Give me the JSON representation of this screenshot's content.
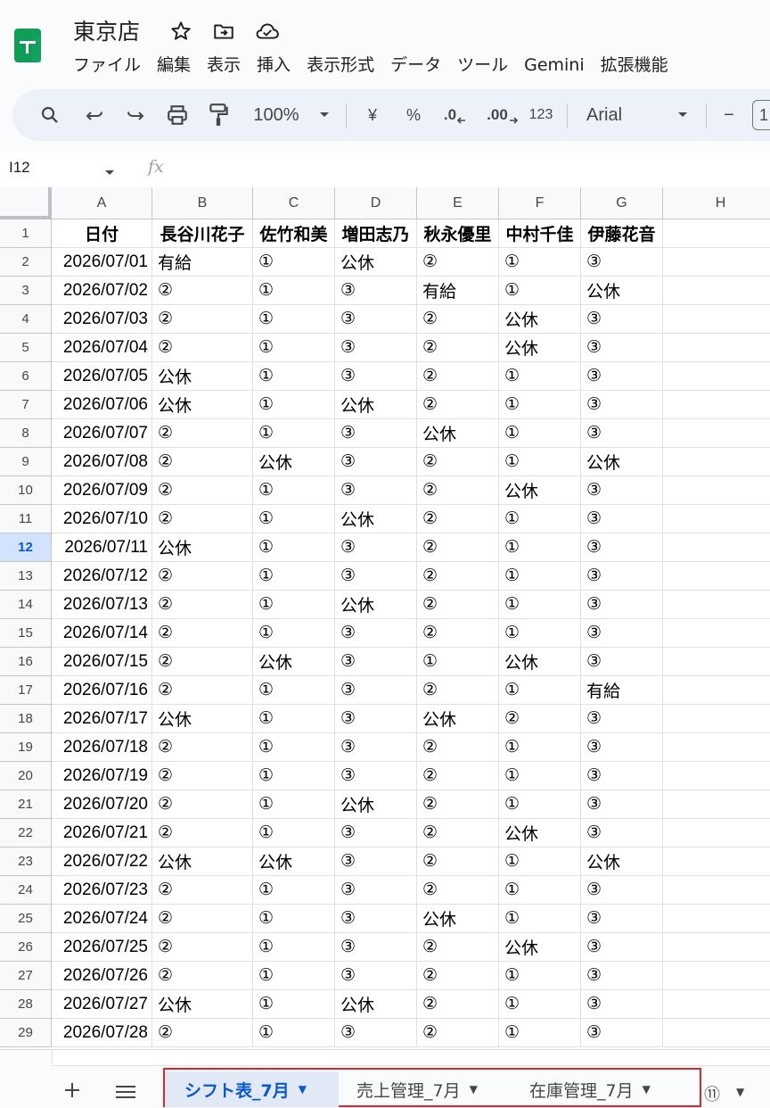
{
  "header": {
    "title": "東京店",
    "menus": [
      "ファイル",
      "編集",
      "表示",
      "挿入",
      "表示形式",
      "データ",
      "ツール",
      "Gemini",
      "拡張機能"
    ]
  },
  "toolbar": {
    "zoom": "100%",
    "currency": "¥",
    "percent": "%",
    "decimal_decrease": ".0",
    "decimal_increase": ".00",
    "number_format": "123",
    "font": "Arial",
    "minus": "−",
    "font_size_partial": "1"
  },
  "formula_bar": {
    "cell_ref": "I12",
    "fx": "fx"
  },
  "grid": {
    "columns": [
      "A",
      "B",
      "C",
      "D",
      "E",
      "F",
      "G",
      "H"
    ],
    "header_row": [
      "日付",
      "長谷川花子",
      "佐竹和美",
      "増田志乃",
      "秋永優里",
      "中村千佳",
      "伊藤花音",
      ""
    ],
    "rows": [
      [
        "2026/07/01",
        "有給",
        "①",
        "公休",
        "②",
        "①",
        "③",
        ""
      ],
      [
        "2026/07/02",
        "②",
        "①",
        "③",
        "有給",
        "①",
        "公休",
        ""
      ],
      [
        "2026/07/03",
        "②",
        "①",
        "③",
        "②",
        "公休",
        "③",
        ""
      ],
      [
        "2026/07/04",
        "②",
        "①",
        "③",
        "②",
        "公休",
        "③",
        ""
      ],
      [
        "2026/07/05",
        "公休",
        "①",
        "③",
        "②",
        "①",
        "③",
        ""
      ],
      [
        "2026/07/06",
        "公休",
        "①",
        "公休",
        "②",
        "①",
        "③",
        ""
      ],
      [
        "2026/07/07",
        "②",
        "①",
        "③",
        "公休",
        "①",
        "③",
        ""
      ],
      [
        "2026/07/08",
        "②",
        "公休",
        "③",
        "②",
        "①",
        "公休",
        ""
      ],
      [
        "2026/07/09",
        "②",
        "①",
        "③",
        "②",
        "公休",
        "③",
        ""
      ],
      [
        "2026/07/10",
        "②",
        "①",
        "公休",
        "②",
        "①",
        "③",
        ""
      ],
      [
        "2026/07/11",
        "公休",
        "①",
        "③",
        "②",
        "①",
        "③",
        ""
      ],
      [
        "2026/07/12",
        "②",
        "①",
        "③",
        "②",
        "①",
        "③",
        ""
      ],
      [
        "2026/07/13",
        "②",
        "①",
        "公休",
        "②",
        "①",
        "③",
        ""
      ],
      [
        "2026/07/14",
        "②",
        "①",
        "③",
        "②",
        "①",
        "③",
        ""
      ],
      [
        "2026/07/15",
        "②",
        "公休",
        "③",
        "①",
        "公休",
        "③",
        ""
      ],
      [
        "2026/07/16",
        "②",
        "①",
        "③",
        "②",
        "①",
        "有給",
        ""
      ],
      [
        "2026/07/17",
        "公休",
        "①",
        "③",
        "公休",
        "②",
        "③",
        ""
      ],
      [
        "2026/07/18",
        "②",
        "①",
        "③",
        "②",
        "①",
        "③",
        ""
      ],
      [
        "2026/07/19",
        "②",
        "①",
        "③",
        "②",
        "①",
        "③",
        ""
      ],
      [
        "2026/07/20",
        "②",
        "①",
        "公休",
        "②",
        "①",
        "③",
        ""
      ],
      [
        "2026/07/21",
        "②",
        "①",
        "③",
        "②",
        "公休",
        "③",
        ""
      ],
      [
        "2026/07/22",
        "公休",
        "公休",
        "③",
        "②",
        "①",
        "公休",
        ""
      ],
      [
        "2026/07/23",
        "②",
        "①",
        "③",
        "②",
        "①",
        "③",
        ""
      ],
      [
        "2026/07/24",
        "②",
        "①",
        "③",
        "公休",
        "①",
        "③",
        ""
      ],
      [
        "2026/07/25",
        "②",
        "①",
        "③",
        "②",
        "公休",
        "③",
        ""
      ],
      [
        "2026/07/26",
        "②",
        "①",
        "③",
        "②",
        "①",
        "③",
        ""
      ],
      [
        "2026/07/27",
        "公休",
        "①",
        "公休",
        "②",
        "①",
        "③",
        ""
      ],
      [
        "2026/07/28",
        "②",
        "①",
        "③",
        "②",
        "①",
        "③",
        ""
      ]
    ],
    "active_row": 12
  },
  "sheets": {
    "tabs": [
      "シフト表_7月",
      "売上管理_7月",
      "在庫管理_7月"
    ],
    "active_index": 0,
    "count": "⑪"
  }
}
